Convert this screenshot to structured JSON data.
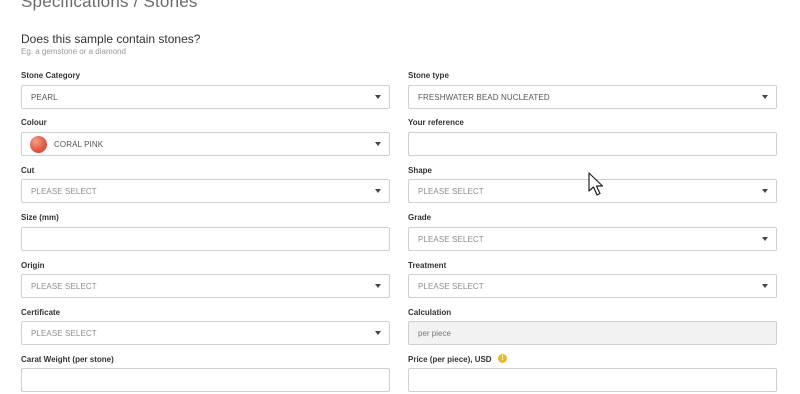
{
  "page": {
    "title": "Specifications / Stones",
    "question": "Does this sample contain stones?",
    "hint": "Eg. a gemstone or a diamond"
  },
  "fields": {
    "stone_category": {
      "label": "Stone Category",
      "value": "PEARL"
    },
    "stone_type": {
      "label": "Stone type",
      "value": "FRESHWATER BEAD NUCLEATED"
    },
    "colour": {
      "label": "Colour",
      "value": "CORAL PINK",
      "swatch_color": "#e15a44"
    },
    "your_reference": {
      "label": "Your reference",
      "value": ""
    },
    "cut": {
      "label": "Cut",
      "placeholder": "PLEASE SELECT"
    },
    "shape": {
      "label": "Shape",
      "placeholder": "PLEASE SELECT"
    },
    "size": {
      "label": "Size (mm)",
      "value": ""
    },
    "grade": {
      "label": "Grade",
      "placeholder": "PLEASE SELECT"
    },
    "origin": {
      "label": "Origin",
      "placeholder": "PLEASE SELECT"
    },
    "treatment": {
      "label": "Treatment",
      "placeholder": "PLEASE SELECT"
    },
    "certificate": {
      "label": "Certificate",
      "placeholder": "PLEASE SELECT"
    },
    "calculation": {
      "label": "Calculation",
      "value": "per piece"
    },
    "carat_weight": {
      "label": "Carat Weight (per stone)",
      "value": ""
    },
    "price": {
      "label": "Price (per piece), USD",
      "value": "",
      "info_icon": "info-icon",
      "info_color": "#e6b82a"
    }
  }
}
